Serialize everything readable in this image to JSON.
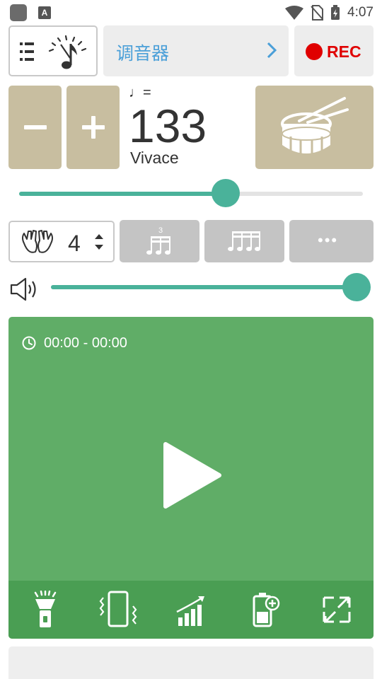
{
  "status_bar": {
    "time": "4:07",
    "notification_badge": "A",
    "icons": [
      "app-notification-icon",
      "wifi-icon",
      "no-sim-icon",
      "battery-charging-icon"
    ]
  },
  "header": {
    "menu_icons": [
      "hamburger-icon",
      "metronome-note-icon"
    ],
    "tuner_label": "调音器",
    "tuner_arrow_icon": "chevron-right-icon",
    "rec_label": "REC"
  },
  "tempo": {
    "decrease_icon": "minus-icon",
    "increase_icon": "plus-icon",
    "note_symbol": "♩=",
    "bpm": "133",
    "marking": "Vivace",
    "accent_button_icon": "snare-drum-icon",
    "slider_fraction": 0.6
  },
  "beats": {
    "icon": "clapping-hands-icon",
    "value": "4",
    "stepper_icon": "up-down-stepper-icon",
    "subdivision_buttons": [
      {
        "icon": "triplet-notes-icon",
        "label": "3"
      },
      {
        "icon": "sixteenth-notes-icon"
      },
      {
        "icon": "more-icon",
        "label": "•••"
      }
    ]
  },
  "volume": {
    "icon": "speaker-icon",
    "fraction": 1.0
  },
  "player": {
    "timer_icon": "clock-icon",
    "timer_text": "00:00 - 00:00",
    "play_icon": "play-icon",
    "toolbar_icons": [
      "flashlight-icon",
      "vibrate-icon",
      "trainer-chart-icon",
      "battery-saver-icon",
      "fullscreen-icon"
    ]
  },
  "colors": {
    "accent_teal": "#4ab29a",
    "panel_green": "#60ad67",
    "toolbar_green": "#4a9e53",
    "tan_button": "#c8bea0",
    "rec_red": "#e00000",
    "tuner_blue": "#4a9fd8"
  }
}
